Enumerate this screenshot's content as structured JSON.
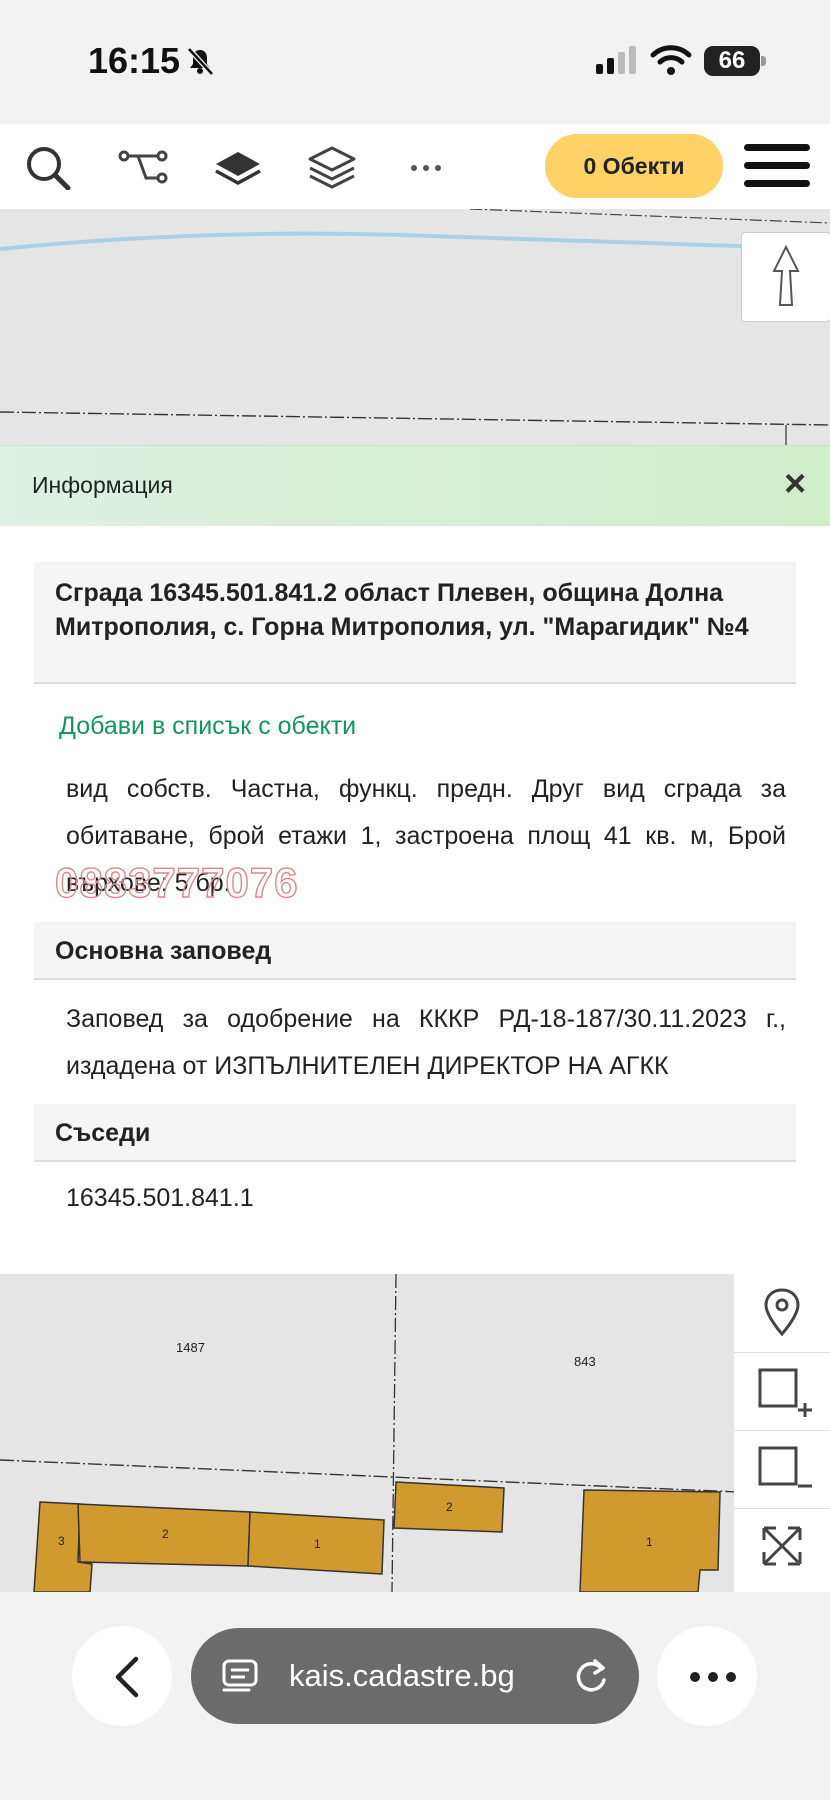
{
  "status_bar": {
    "time": "16:15",
    "battery": "66"
  },
  "toolbar": {
    "objects_button": "0 Обекти"
  },
  "map_top": {},
  "info_panel": {
    "header_title": "Информация",
    "close_label": "×",
    "building_title": "Сграда 16345.501.841.2 област Плевен, община Долна Митрополия, с. Горна Митрополия, ул. \"Марагидик\" №4",
    "add_to_list": "Добави в списък с обекти",
    "description": "вид собств. Частна, функц. предн. Друг вид сграда за обитаване, брой етажи 1, застроена площ 41 кв. м, Брой върхове: 5 бр.",
    "watermark": "0883777076",
    "basic_order_heading": "Основна заповед",
    "basic_order_text": "Заповед за одобрение на КККР РД-18-187/30.11.2023 г., издадена от ИЗПЪЛНИТЕЛЕН ДИРЕКТОР НА АГКК",
    "neighbors_heading": "Съседи",
    "neighbors_value": "16345.501.841.1"
  },
  "map_bottom": {
    "parcel_labels": [
      "1487",
      "843"
    ],
    "building_labels": [
      "3",
      "2",
      "1",
      "2",
      "1"
    ]
  },
  "browser": {
    "url": "kais.cadastre.bg"
  },
  "colors": {
    "accent_yellow": "#ffd166",
    "link_green": "#16945e",
    "building_fill": "#d19a2e",
    "header_green": "#d4efd7"
  }
}
